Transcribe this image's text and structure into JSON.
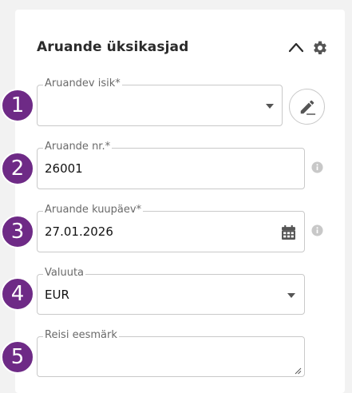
{
  "panel": {
    "title": "Aruande üksikasjad",
    "collapse_icon": "chevron-up-icon",
    "settings_icon": "gear-icon"
  },
  "fields": [
    {
      "step": "1",
      "label": "Aruandev isik*",
      "value": "",
      "icon": "dropdown-caret-icon"
    },
    {
      "step": "2",
      "label": "Aruande nr.*",
      "value": "26001",
      "icon": "info-icon"
    },
    {
      "step": "3",
      "label": "Aruande kuupäev*",
      "value": "27.01.2026",
      "icon": "calendar-icon"
    },
    {
      "step": "4",
      "label": "Valuuta",
      "value": "EUR",
      "icon": "dropdown-caret-icon"
    },
    {
      "step": "5",
      "label": "Reisi eesmärk",
      "value": "",
      "icon": "resize-handle-icon"
    }
  ],
  "colors": {
    "badge": "#6e2a86",
    "border": "#c9c9c9",
    "icon": "#555555",
    "info_icon": "#c8c8c8"
  }
}
